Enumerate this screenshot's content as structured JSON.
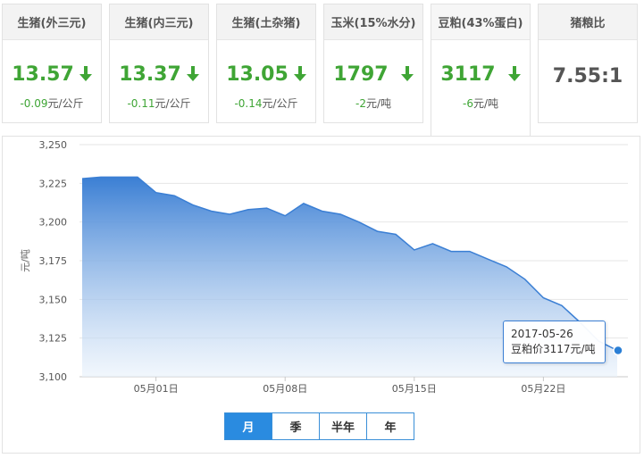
{
  "cards": [
    {
      "title": "生猪(外三元)",
      "price": "13.57",
      "change": "-0.09",
      "unit": "元/公斤",
      "trend": "down"
    },
    {
      "title": "生猪(内三元)",
      "price": "13.37",
      "change": "-0.11",
      "unit": "元/公斤",
      "trend": "down"
    },
    {
      "title": "生猪(土杂猪)",
      "price": "13.05",
      "change": "-0.14",
      "unit": "元/公斤",
      "trend": "down"
    },
    {
      "title": "玉米(15%水分)",
      "price": "1797",
      "change": "-2",
      "unit": "元/吨",
      "trend": "down"
    },
    {
      "title": "豆粕(43%蛋白)",
      "price": "3117",
      "change": "-6",
      "unit": "元/吨",
      "trend": "down"
    },
    {
      "title": "猪粮比",
      "price": "7.55:1",
      "change": "",
      "unit": "",
      "trend": "none"
    }
  ],
  "tooltip": {
    "date": "2017-05-26",
    "label": "豆粕价3117元/吨"
  },
  "range_buttons": [
    "月",
    "季",
    "半年",
    "年"
  ],
  "colors": {
    "accent": "#2a8be0",
    "down": "#3fa535",
    "area_top": "#3b7fd4"
  },
  "chart_data": {
    "type": "area",
    "ylabel": "元/吨",
    "ylim": [
      3100,
      3250
    ],
    "yticks": [
      3100,
      3125,
      3150,
      3175,
      3200,
      3225,
      3250
    ],
    "yticklabels": [
      "3,100",
      "3,125",
      "3,150",
      "3,175",
      "3,200",
      "3,225",
      "3,250"
    ],
    "xticks": [
      "2017-05-01",
      "2017-05-08",
      "2017-05-15",
      "2017-05-22"
    ],
    "xticklabels": [
      "05月01日",
      "05月08日",
      "05月15日",
      "05月22日"
    ],
    "series": [
      {
        "x": [
          "2017-04-27",
          "2017-04-28",
          "2017-04-29",
          "2017-04-30",
          "2017-05-01",
          "2017-05-02",
          "2017-05-03",
          "2017-05-04",
          "2017-05-05",
          "2017-05-06",
          "2017-05-07",
          "2017-05-08",
          "2017-05-09",
          "2017-05-10",
          "2017-05-11",
          "2017-05-12",
          "2017-05-13",
          "2017-05-14",
          "2017-05-15",
          "2017-05-16",
          "2017-05-17",
          "2017-05-18",
          "2017-05-19",
          "2017-05-20",
          "2017-05-21",
          "2017-05-22",
          "2017-05-23",
          "2017-05-24",
          "2017-05-25",
          "2017-05-26"
        ],
        "values": [
          3228,
          3229,
          3229,
          3229,
          3219,
          3217,
          3211,
          3207,
          3205,
          3208,
          3209,
          3204,
          3212,
          3207,
          3205,
          3200,
          3194,
          3192,
          3182,
          3186,
          3181,
          3181,
          3176,
          3171,
          3163,
          3151,
          3146,
          3135,
          3123,
          3117
        ]
      }
    ],
    "highlight": {
      "x": "2017-05-26",
      "value": 3117
    },
    "grid": true,
    "legend": "none"
  }
}
